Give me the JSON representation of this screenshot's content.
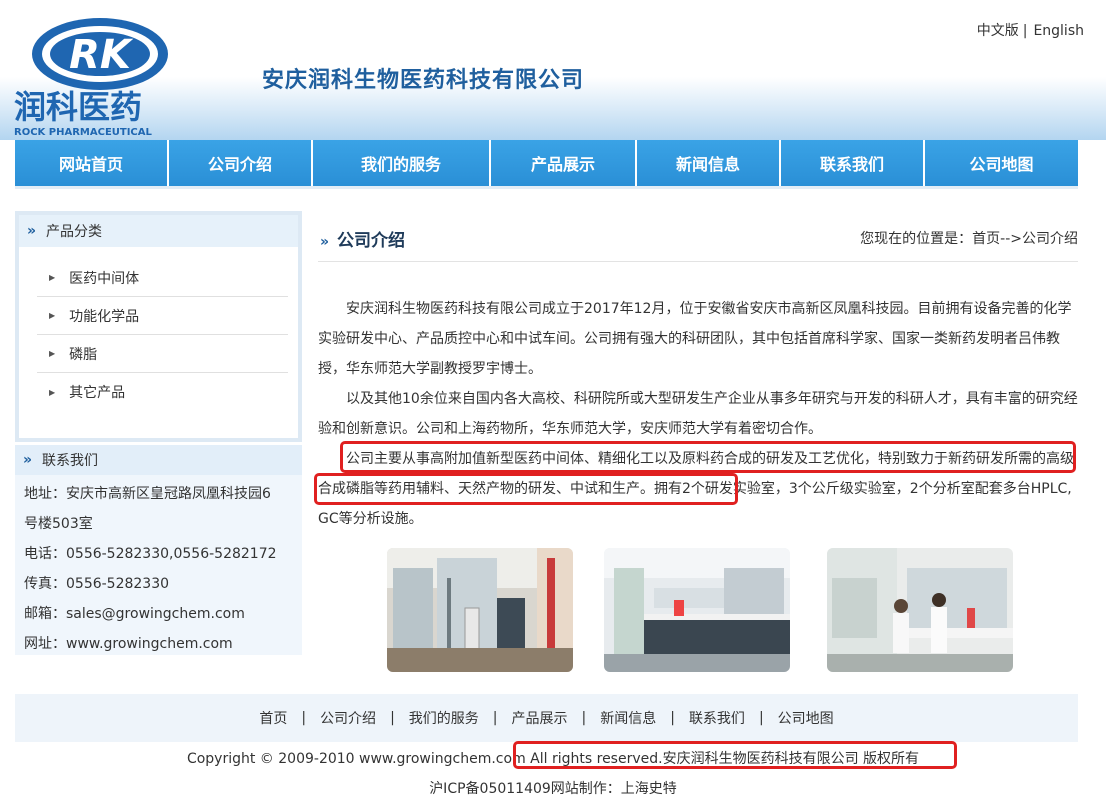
{
  "header": {
    "logo_text_cn": "润科医药",
    "logo_text_en": "ROCK PHARMACEUTICAL",
    "logo_mark": "RK",
    "company_name": "安庆润科生物医药科技有限公司",
    "lang_cn": "中文版",
    "lang_sep": "|",
    "lang_en": "English"
  },
  "nav": {
    "items": [
      "网站首页",
      "公司介绍",
      "我们的服务",
      "产品展示",
      "新闻信息",
      "联系我们",
      "公司地图"
    ]
  },
  "sidebar": {
    "categories_title": "产品分类",
    "categories": [
      "医药中间体",
      "功能化学品",
      "磷脂",
      "其它产品"
    ],
    "contact_title": "联系我们",
    "contact_lines": [
      "地址：安庆市高新区皇冠路凤凰科技园6",
      "号楼503室",
      "电话：0556-5282330,0556-5282172",
      "传真：0556-5282330",
      "邮箱：sales@growingchem.com",
      "网址：www.growingchem.com"
    ]
  },
  "main": {
    "title": "公司介绍",
    "breadcrumb": "您现在的位置是：首页-->公司介绍",
    "paragraphs": [
      "安庆润科生物医药科技有限公司成立于2017年12月，位于安徽省安庆市高新区凤凰科技园。目前拥有设备完善的化学实验研发中心、产品质控中心和中试车间。公司拥有强大的科研团队，其中包括首席科学家、国家一类新药发明者吕伟教授，华东师范大学副教授罗宇博士。",
      "以及其他10余位来自国内各大高校、科研院所或大型研发生产企业从事多年研究与开发的科研人才，具有丰富的研究经验和创新意识。公司和上海药物所，华东师范大学，安庆师范大学有着密切合作。",
      "公司主要从事高附加值新型医药中间体、精细化工以及原料药合成的研发及工艺优化，特别致力于新药研发所需的高级合成磷脂等药用辅料、天然产物的研发、中试和生产。拥有2个研发实验室，3个公斤级实验室，2个分析室配套多台HPLC, GC等分析设施。"
    ]
  },
  "footer": {
    "links": [
      "首页",
      "公司介绍",
      "我们的服务",
      "产品展示",
      "新闻信息",
      "联系我们",
      "公司地图"
    ],
    "sep": "|",
    "copyright_prefix": "Copyright © 2009-2010 www.growingchem.com ",
    "copyright_highlight": "All rights reserved.安庆润科生物医药科技有限公司 版权所有",
    "icp": "沪ICP备05011409网站制作：上海史特"
  },
  "colors": {
    "nav_blue": "#2a8fd6",
    "title_blue": "#1f5f9e",
    "highlight_red": "#e02020"
  }
}
